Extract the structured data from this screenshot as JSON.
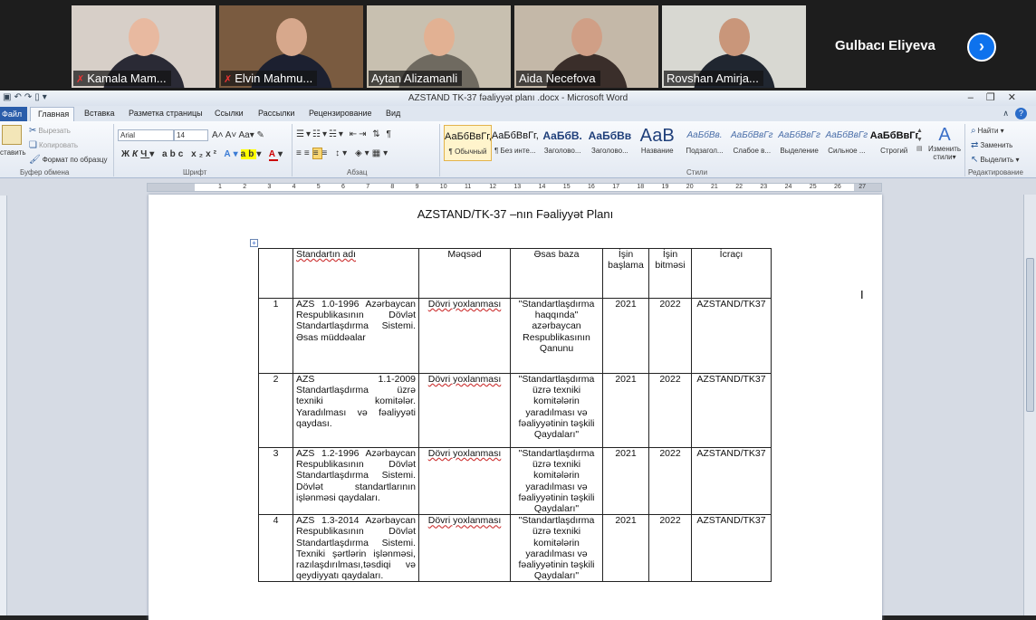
{
  "participants": [
    {
      "name": "Kamala Mam...",
      "muted": true,
      "bg": "#d7cfc8",
      "skin": "#e8b9a0",
      "clothes": "#2a2a35"
    },
    {
      "name": "Elvin Mahmu...",
      "muted": true,
      "bg": "#7a5b40",
      "skin": "#d7a88c",
      "clothes": "#1c2030"
    },
    {
      "name": "Aytan Alizamanli",
      "muted": false,
      "bg": "#c8c0b0",
      "skin": "#e2b193",
      "clothes": "#6f6a60"
    },
    {
      "name": "Aida Necefova",
      "muted": false,
      "bg": "#c4b8a8",
      "skin": "#d09f86",
      "clothes": "#3a2e2a"
    },
    {
      "name": "Rovshan Amirja...",
      "muted": false,
      "bg": "#d8d8d2",
      "skin": "#c9967a",
      "clothes": "#202630"
    }
  ],
  "more_participant": "Gulbacı Eliyeva",
  "window": {
    "title": "AZSTAND TK-37 fəaliyyət planı .docx  -  Microsoft Word"
  },
  "ribbon_tabs": [
    "Файл",
    "Главная",
    "Вставка",
    "Разметка страницы",
    "Ссылки",
    "Рассылки",
    "Рецензирование",
    "Вид"
  ],
  "clipboard": {
    "paste": "ставить",
    "cut": "Вырезать",
    "copy": "Копировать",
    "format": "Формат по образцу",
    "label": "Буфер обмена"
  },
  "font": {
    "name": "Arial",
    "size": "14",
    "label": "Шрифт"
  },
  "paragraph": {
    "label": "Абзац"
  },
  "styles": {
    "label": "Стили",
    "change": "Изменить стили",
    "items": [
      {
        "preview": "АаБбВвГг,",
        "label": "¶ Обычный",
        "selected": true
      },
      {
        "preview": "АаБбВвГг,",
        "label": "¶ Без инте..."
      },
      {
        "preview": "АаБбВ.",
        "label": "Заголово..."
      },
      {
        "preview": "АаБбВв",
        "label": "Заголово..."
      },
      {
        "preview": "АаВ",
        "label": "Название"
      },
      {
        "preview": "АаБбВв.",
        "label": "Подзагол..."
      },
      {
        "preview": "АаБбВвГг",
        "label": "Слабое в..."
      },
      {
        "preview": "АаБбВвГг",
        "label": "Выделение"
      },
      {
        "preview": "АаБбВвГг",
        "label": "Сильное ..."
      },
      {
        "preview": "АаБбВвГг,",
        "label": "Строгий"
      }
    ]
  },
  "editing": {
    "find": "Найти",
    "replace": "Заменить",
    "select": "Выделить",
    "label": "Редактирование"
  },
  "ruler_marks": [
    "1",
    "2",
    "3",
    "4",
    "5",
    "6",
    "7",
    "8",
    "9",
    "10",
    "11",
    "12",
    "13",
    "14",
    "15",
    "16",
    "17",
    "18",
    "19",
    "20",
    "21",
    "22",
    "23",
    "24",
    "25",
    "26",
    "27"
  ],
  "document": {
    "title": "AZSTAND/TK-37 –nın   Fəaliyyət Planı",
    "headers": [
      "",
      "Standartın adı",
      "Məqsəd",
      "Əsas baza",
      "İşin başlama",
      "İşin bitməsi",
      "İcraçı"
    ],
    "rows": [
      {
        "no": "1",
        "name": "AZS 1.0-1996 Azərbaycan Respublikasının Dövlət Standartlaşdırma Sistemi. Əsas müddəalar",
        "goal": "Dövri yoxlanması",
        "base": "\"Standartlaşdırma haqqında\" azərbaycan Respublikasının Qanunu",
        "start": "2021",
        "end": "2022",
        "exec": "AZSTAND/TK37"
      },
      {
        "no": "2",
        "name": "AZS 1.1-2009 Standartlaşdırma üzrə texniki komitələr. Yaradılması və fəaliyyəti qaydası.",
        "goal": "Dövri yoxlanması",
        "base": "\"Standartlaşdırma üzrə texniki komitələrin yaradılması və fəaliyyətinin təşkili Qaydaları\"",
        "start": "2021",
        "end": "2022",
        "exec": "AZSTAND/TK37"
      },
      {
        "no": "3",
        "name": "AZS 1.2-1996 Azərbaycan Respublikasının Dövlət Standartlaşdırma Sistemi. Dövlət standartlarının işlənməsi qaydaları.",
        "goal": "Dövri yoxlanması",
        "base": "\"Standartlaşdırma üzrə texniki komitələrin yaradılması və fəaliyyətinin təşkili Qaydaları\"",
        "start": "2021",
        "end": "2022",
        "exec": "AZSTAND/TK37"
      },
      {
        "no": "4",
        "name": "AZS 1.3-2014 Azərbaycan Respublikasının Dövlət Standartlaşdırma Sistemi. Texniki şərtlərin işlənməsi, razılaşdırılması,təsdiqi  və qeydiyyatı qaydaları.",
        "goal": "Dövri yoxlanması",
        "base": "\"Standartlaşdırma üzrə texniki komitələrin yaradılması və fəaliyyətinin təşkili Qaydaları\"",
        "start": "2021",
        "end": "2022",
        "exec": "AZSTAND/TK37"
      }
    ]
  }
}
